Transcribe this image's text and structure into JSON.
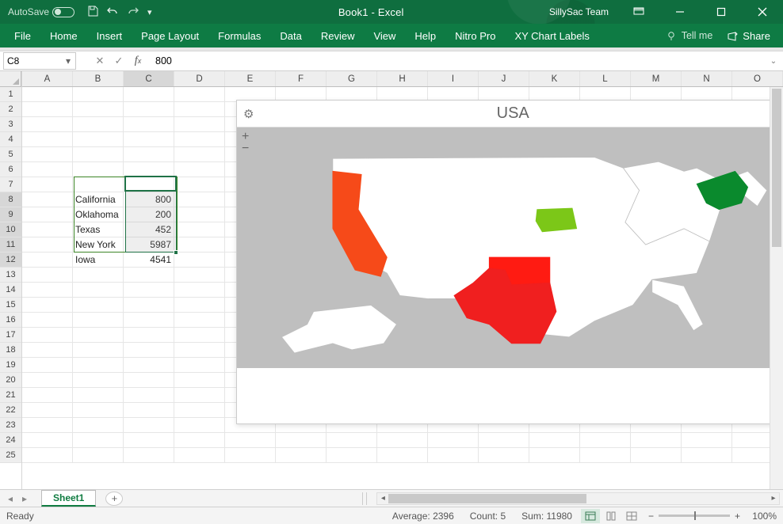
{
  "titlebar": {
    "autosave_label": "AutoSave",
    "autosave_state": "Off",
    "document_title": "Book1 - Excel",
    "user": "SillySac Team"
  },
  "ribbon": {
    "tabs": [
      "File",
      "Home",
      "Insert",
      "Page Layout",
      "Formulas",
      "Data",
      "Review",
      "View",
      "Help",
      "Nitro Pro",
      "XY Chart Labels"
    ],
    "tell_me": "Tell me",
    "share": "Share"
  },
  "formula_bar": {
    "name_box": "C8",
    "formula": "800"
  },
  "columns": [
    "A",
    "B",
    "C",
    "D",
    "E",
    "F",
    "G",
    "H",
    "I",
    "J",
    "K",
    "L",
    "M",
    "N",
    "O"
  ],
  "row_numbers": [
    1,
    2,
    3,
    4,
    5,
    6,
    7,
    8,
    9,
    10,
    11,
    12,
    13,
    14,
    15,
    16,
    17,
    18,
    19,
    20,
    21,
    22,
    23,
    24,
    25
  ],
  "data": {
    "B8": "California",
    "C8": "800",
    "B9": "Oklahoma",
    "C9": "200",
    "B10": "Texas",
    "C10": "452",
    "B11": "New York",
    "C11": "5987",
    "B12": "Iowa",
    "C12": "4541"
  },
  "chart": {
    "title": "USA"
  },
  "chart_data": {
    "type": "map",
    "region": "USA",
    "series": [
      {
        "name": "California",
        "value": 800,
        "color": "#f64a19"
      },
      {
        "name": "Oklahoma",
        "value": 200,
        "color": "#ff1b12"
      },
      {
        "name": "Texas",
        "value": 452,
        "color": "#f01f1f"
      },
      {
        "name": "New York",
        "value": 5987,
        "color": "#0a8a2d"
      },
      {
        "name": "Iowa",
        "value": 4541,
        "color": "#7cc718"
      }
    ]
  },
  "sheets": {
    "active": "Sheet1"
  },
  "status": {
    "mode": "Ready",
    "average": "Average: 2396",
    "count": "Count: 5",
    "sum": "Sum: 11980",
    "zoom": "100%"
  }
}
